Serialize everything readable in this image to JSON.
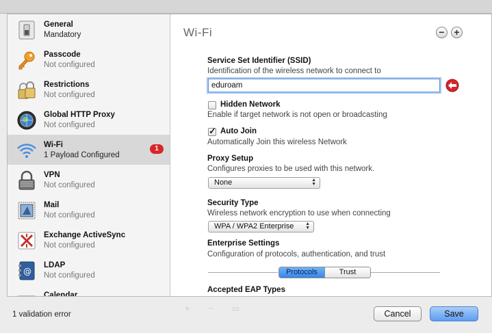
{
  "sidebar": {
    "items": [
      {
        "title": "General",
        "subtitle": "Mandatory",
        "icon": "switch-icon"
      },
      {
        "title": "Passcode",
        "subtitle": "Not configured",
        "icon": "key-icon"
      },
      {
        "title": "Restrictions",
        "subtitle": "Not configured",
        "icon": "padlocks-icon"
      },
      {
        "title": "Global HTTP Proxy",
        "subtitle": "Not configured",
        "icon": "globe-icon"
      },
      {
        "title": "Wi-Fi",
        "subtitle": "1 Payload Configured",
        "icon": "wifi-icon",
        "badge": "1"
      },
      {
        "title": "VPN",
        "subtitle": "Not configured",
        "icon": "vpn-lock-icon"
      },
      {
        "title": "Mail",
        "subtitle": "Not configured",
        "icon": "mail-stamp-icon"
      },
      {
        "title": "Exchange ActiveSync",
        "subtitle": "Not configured",
        "icon": "exchange-icon"
      },
      {
        "title": "LDAP",
        "subtitle": "Not configured",
        "icon": "address-book-icon"
      },
      {
        "title": "Calendar",
        "subtitle": "",
        "icon": "calendar-icon"
      }
    ]
  },
  "main": {
    "title": "Wi-Fi",
    "ssid": {
      "label": "Service Set Identifier (SSID)",
      "description": "Identification of the wireless network to connect to",
      "value": "eduroam"
    },
    "hidden_network": {
      "label": "Hidden Network",
      "description": "Enable if target network is not open or broadcasting",
      "checked": false
    },
    "auto_join": {
      "label": "Auto Join",
      "description": "Automatically Join this wireless Network",
      "checked": true
    },
    "proxy_setup": {
      "label": "Proxy Setup",
      "description": "Configures proxies to be used with this network.",
      "value": "None"
    },
    "security_type": {
      "label": "Security Type",
      "description": "Wireless network encryption to use when connecting",
      "value": "WPA / WPA2 Enterprise"
    },
    "enterprise": {
      "label": "Enterprise Settings",
      "description": "Configuration of protocols, authentication, and trust",
      "tabs": [
        "Protocols",
        "Trust"
      ],
      "active_tab": "Protocols"
    },
    "eap": {
      "label": "Accepted EAP Types"
    }
  },
  "footer": {
    "validation": "1 validation error",
    "cancel_label": "Cancel",
    "save_label": "Save"
  },
  "colors": {
    "error": "#d6262a",
    "accent": "#3785ea"
  }
}
